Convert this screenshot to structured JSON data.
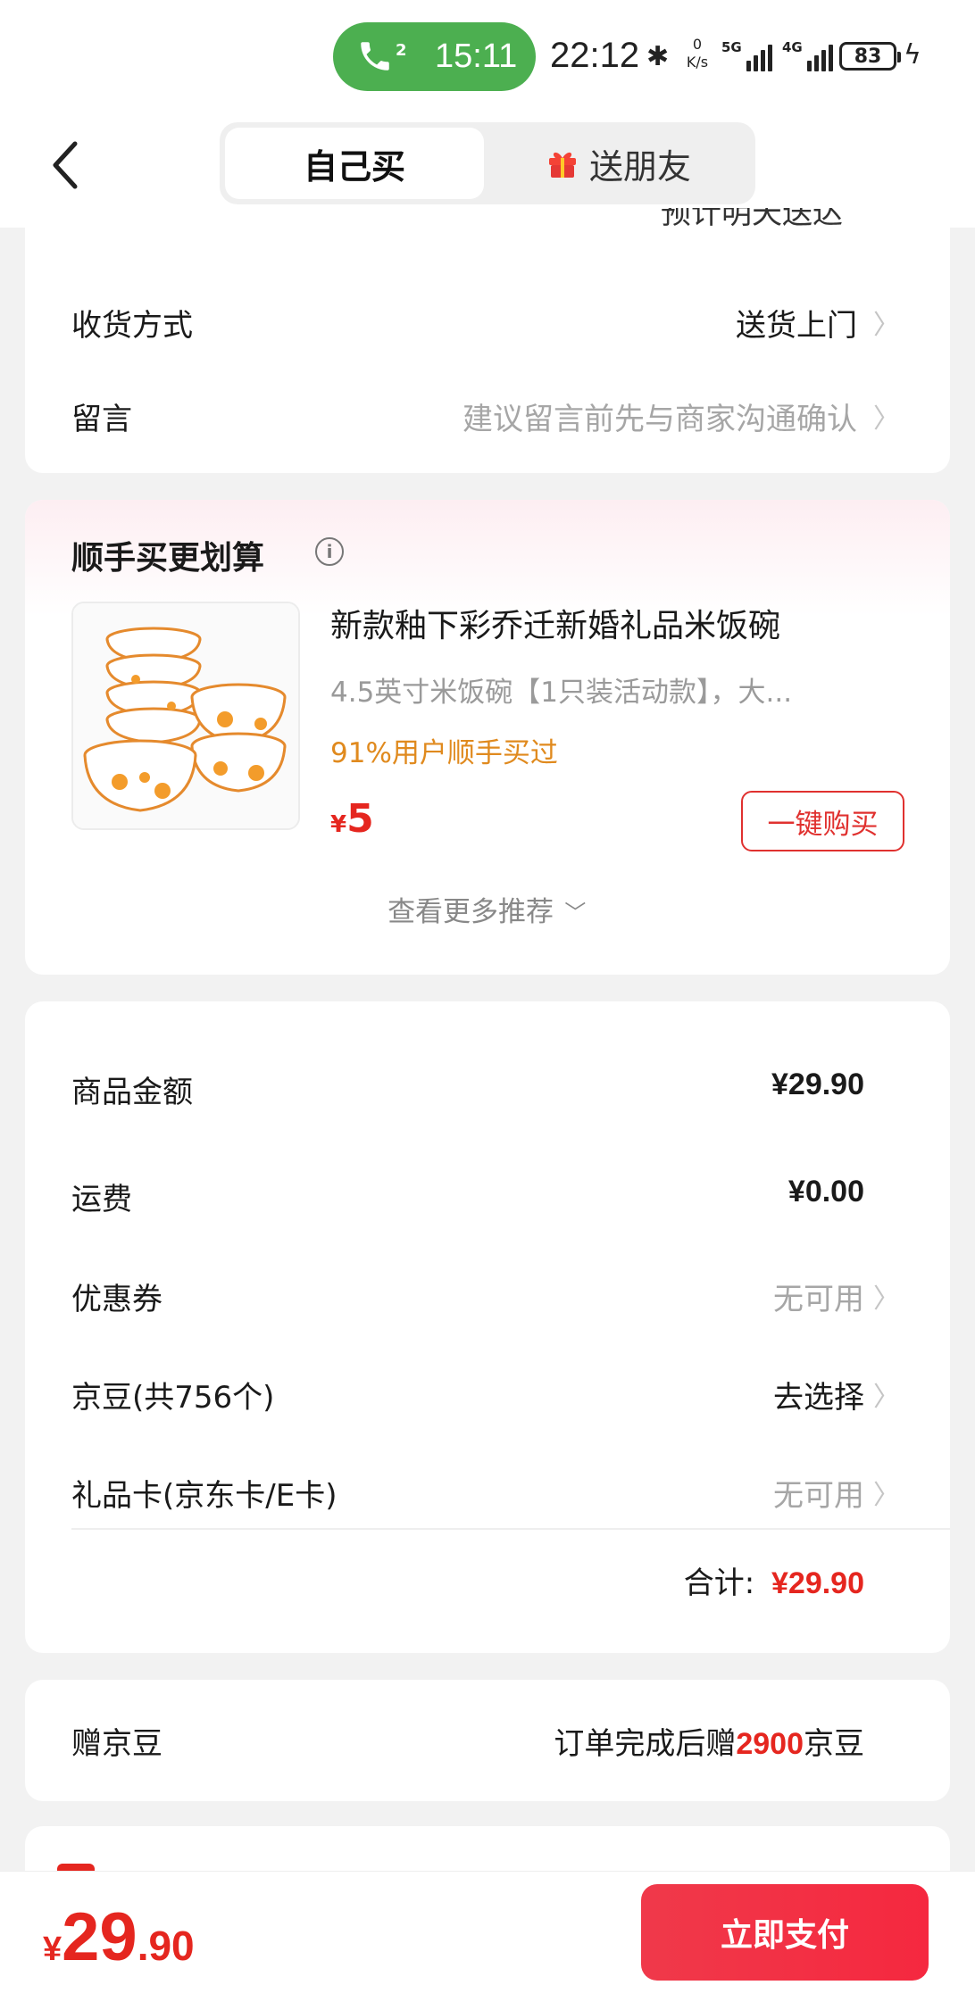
{
  "status_bar": {
    "call_count": "2",
    "call_time": "15:11",
    "clock": "22:12",
    "net_speed_value": "0",
    "net_speed_unit": "K/s",
    "sig1_label": "5G",
    "sig2_label": "4G",
    "battery": "83",
    "colors": {
      "call_pill": "#4caf50"
    }
  },
  "header": {
    "tabs": [
      {
        "label": "自己买",
        "active": true
      },
      {
        "label": "送朋友",
        "active": false
      }
    ]
  },
  "delivery": {
    "partial_text": "预计明天送达",
    "method_label": "收货方式",
    "method_value": "送货上门",
    "note_label": "留言",
    "note_placeholder": "建议留言前先与商家沟通确认"
  },
  "recommend": {
    "title": "顺手买更划算",
    "product": {
      "name": "新款釉下彩乔迁新婚礼品米饭碗",
      "spec": "4.5英寸米饭碗【1只装活动款】，大...",
      "social_proof": "91%用户顺手买过",
      "currency": "¥",
      "price": "5",
      "buy_label": "一键购买"
    },
    "more_label": "查看更多推荐"
  },
  "summary": {
    "rows": [
      {
        "label": "商品金额",
        "value": "¥29.90"
      },
      {
        "label": "运费",
        "value": "¥0.00"
      },
      {
        "label": "优惠券",
        "value": "无可用"
      },
      {
        "label": "京豆(共756个)",
        "value": "去选择"
      },
      {
        "label": "礼品卡(京东卡/E卡)",
        "value": "无可用"
      }
    ],
    "total_label": "合计:",
    "total_value": "¥29.90"
  },
  "bonus": {
    "label": "赠京豆",
    "text_before": "订单完成后赠",
    "amount": "2900",
    "text_after": "京豆"
  },
  "bottom_bar": {
    "currency": "¥",
    "price_int": "29",
    "price_dec": ".90",
    "pay_label": "立即支付"
  },
  "colors": {
    "accent_red": "#e5261f",
    "orange_text": "#e08a1e"
  }
}
